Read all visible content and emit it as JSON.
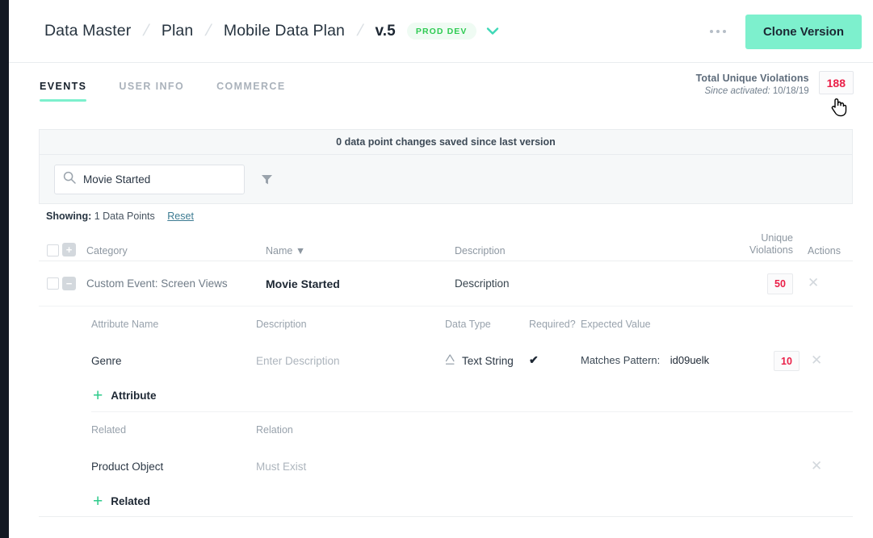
{
  "header": {
    "breadcrumb": [
      {
        "label": "Data Master"
      },
      {
        "label": "Plan"
      },
      {
        "label": "Mobile Data Plan"
      },
      {
        "label": "v.5"
      }
    ],
    "separator": "/",
    "env_badge": "PROD DEV",
    "chevron_icon": "chevron-down-icon",
    "more_icon": "ellipsis-icon",
    "clone_label": "Clone Version"
  },
  "tabs": [
    {
      "label": "EVENTS",
      "active": true
    },
    {
      "label": "USER INFO",
      "active": false
    },
    {
      "label": "COMMERCE",
      "active": false
    }
  ],
  "violations": {
    "title": "Total Unique Violations",
    "since_label": "Since activated:",
    "since_date": "10/18/19",
    "count": "188",
    "cursor_icon": "pointing-hand-cursor"
  },
  "panel": {
    "notice": "0 data point changes saved since last version",
    "search": {
      "icon": "search-icon",
      "value": "Movie Started",
      "placeholder": "Search"
    },
    "filter_icon": "funnel-icon"
  },
  "showing": {
    "prefix": "Showing:",
    "count_text": "1 Data Points",
    "reset_label": "Reset"
  },
  "table": {
    "columns": {
      "category": "Category",
      "name": "Name",
      "name_sort_icon": "sort-desc-icon",
      "description": "Description",
      "violations_line1": "Unique",
      "violations_line2": "Violations",
      "actions": "Actions"
    },
    "header_expand_icon": "plus-box-icon",
    "row": {
      "expand_icon": "minus-box-icon",
      "category": "Custom Event: Screen Views",
      "name": "Movie Started",
      "description": "Description",
      "violations": "50",
      "delete_icon": "close-icon"
    }
  },
  "attributes": {
    "columns": {
      "name": "Attribute Name",
      "description": "Description",
      "data_type": "Data Type",
      "required": "Required?",
      "expected_value": "Expected Value"
    },
    "rows": [
      {
        "name": "Genre",
        "description_placeholder": "Enter Description",
        "data_type": "Text String",
        "data_type_icon": "text-string-icon",
        "required_icon": "checkmark-icon",
        "expected_label": "Matches Pattern:",
        "expected_value": "id09uelk",
        "violations": "10",
        "delete_icon": "close-icon"
      }
    ],
    "add_label": "Attribute",
    "add_icon": "plus-icon"
  },
  "related": {
    "columns": {
      "related": "Related",
      "relation": "Relation"
    },
    "rows": [
      {
        "name": "Product Object",
        "relation": "Must Exist",
        "delete_icon": "close-icon"
      }
    ],
    "add_label": "Related",
    "add_icon": "plus-icon"
  },
  "colors": {
    "accent_mint": "#7df0cd",
    "green": "#2ecb52",
    "red": "#ea1f48",
    "dark": "#1d2733"
  }
}
